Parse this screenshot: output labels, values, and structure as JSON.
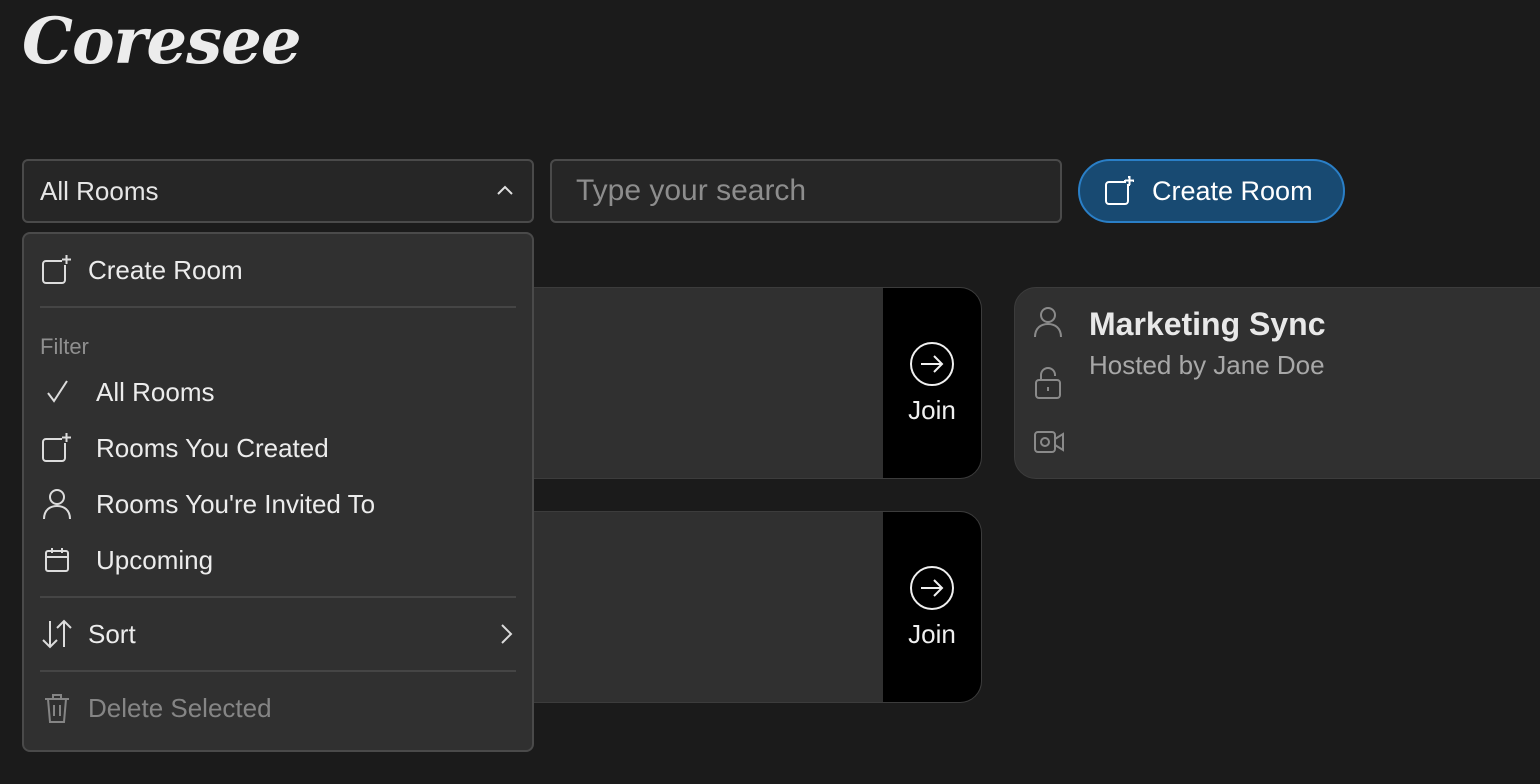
{
  "app": {
    "logo": "Coresee"
  },
  "toolbar": {
    "select_value": "All Rooms",
    "search_placeholder": "Type your search",
    "create_label": "Create Room"
  },
  "menu": {
    "create_label": "Create Room",
    "filter_heading": "Filter",
    "filters": [
      {
        "label": "All Rooms",
        "icon": "check-icon",
        "selected": true
      },
      {
        "label": "Rooms You Created",
        "icon": "create-room-icon",
        "selected": false
      },
      {
        "label": "Rooms You're Invited To",
        "icon": "person-icon",
        "selected": false
      },
      {
        "label": "Upcoming",
        "icon": "calendar-icon",
        "selected": false
      }
    ],
    "sort_label": "Sort",
    "delete_label": "Delete Selected"
  },
  "rooms": [
    {
      "join_label": "Join"
    },
    {
      "join_label": "Join"
    },
    {
      "title": "Marketing Sync",
      "host": "Hosted by Jane Doe"
    }
  ],
  "colors": {
    "accent": "#2a7fc7",
    "accent_bg": "#184a72",
    "background": "#1b1b1b",
    "panel": "#303030"
  }
}
